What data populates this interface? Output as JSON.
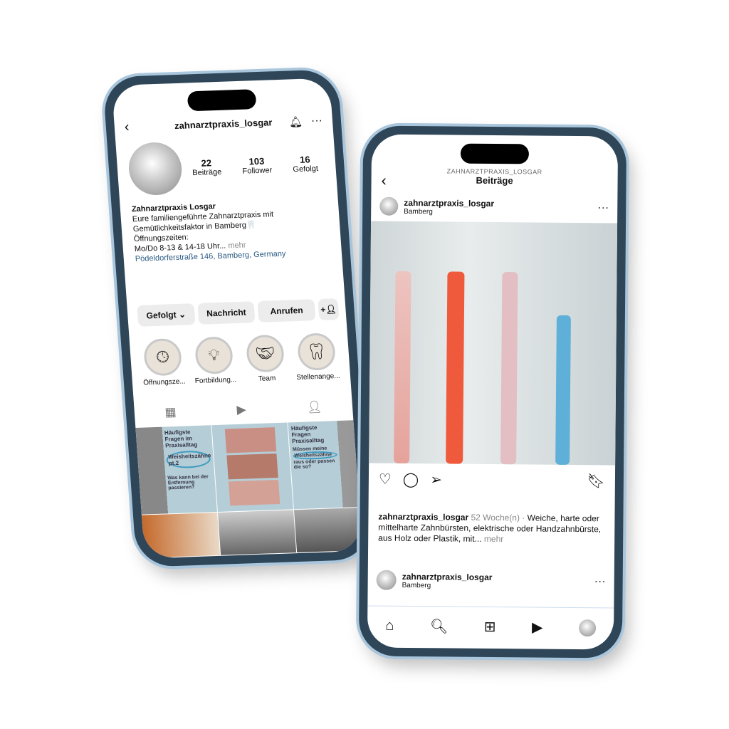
{
  "profile_screen": {
    "username": "zahnarztpraxis_losgar",
    "stats": [
      {
        "value": "22",
        "label": "Beiträge"
      },
      {
        "value": "103",
        "label": "Follower"
      },
      {
        "value": "16",
        "label": "Gefolgt"
      }
    ],
    "name": "Zahnarztpraxis Losgar",
    "bio_line1": "Eure familiengeführte Zahnarztpraxis mit",
    "bio_line2": "Gemütlichkeitsfaktor in Bamberg🦷",
    "bio_line3": "Öffnungszeiten:",
    "bio_line4": "Mo/Do 8-13 & 14-18 Uhr...",
    "more": "mehr",
    "address": "Pödeldorferstraße 146, Bamberg, Germany",
    "buttons": {
      "follow": "Gefolgt",
      "message": "Nachricht",
      "call": "Anrufen"
    },
    "highlights": [
      {
        "label": "Öffnungsze...",
        "icon": "clock-icon"
      },
      {
        "label": "Fortbildung...",
        "icon": "lightbulb-icon"
      },
      {
        "label": "Team",
        "icon": "handshake-icon"
      },
      {
        "label": "Stellenange...",
        "icon": "tooth-icon"
      }
    ],
    "posts": {
      "p1_title": "Häufigste Fragen im Praxisalltag",
      "p1_highlight": "Weisheitszähne pt.2",
      "p1_sub": "Was kann bei der Entfernung passieren?",
      "p3_title": "Häufigste Fragen Praxisalltag",
      "p3_q1": "Müssen meine",
      "p3_highlight": "Weisheitszähne",
      "p3_q2": "raus oder passen die so?"
    },
    "colors": {
      "link": "#2b5b84",
      "post_bg": "#b5cdd6"
    }
  },
  "post_screen": {
    "header_sub": "ZAHNARZTPRAXIS_LOSGAR",
    "header_title": "Beiträge",
    "author": "zahnarztpraxis_losgar",
    "location": "Bamberg",
    "caption_user": "zahnarztpraxis_losgar",
    "caption_time": "52 Woche(n) ·",
    "caption_text": "Weiche, harte oder mittelharte Zahnbürsten, elektrische oder Handzahnbürste, aus Holz oder Plastik, mit...",
    "caption_more": "mehr",
    "next_author": "zahnarztpraxis_losgar",
    "next_location": "Bamberg"
  }
}
